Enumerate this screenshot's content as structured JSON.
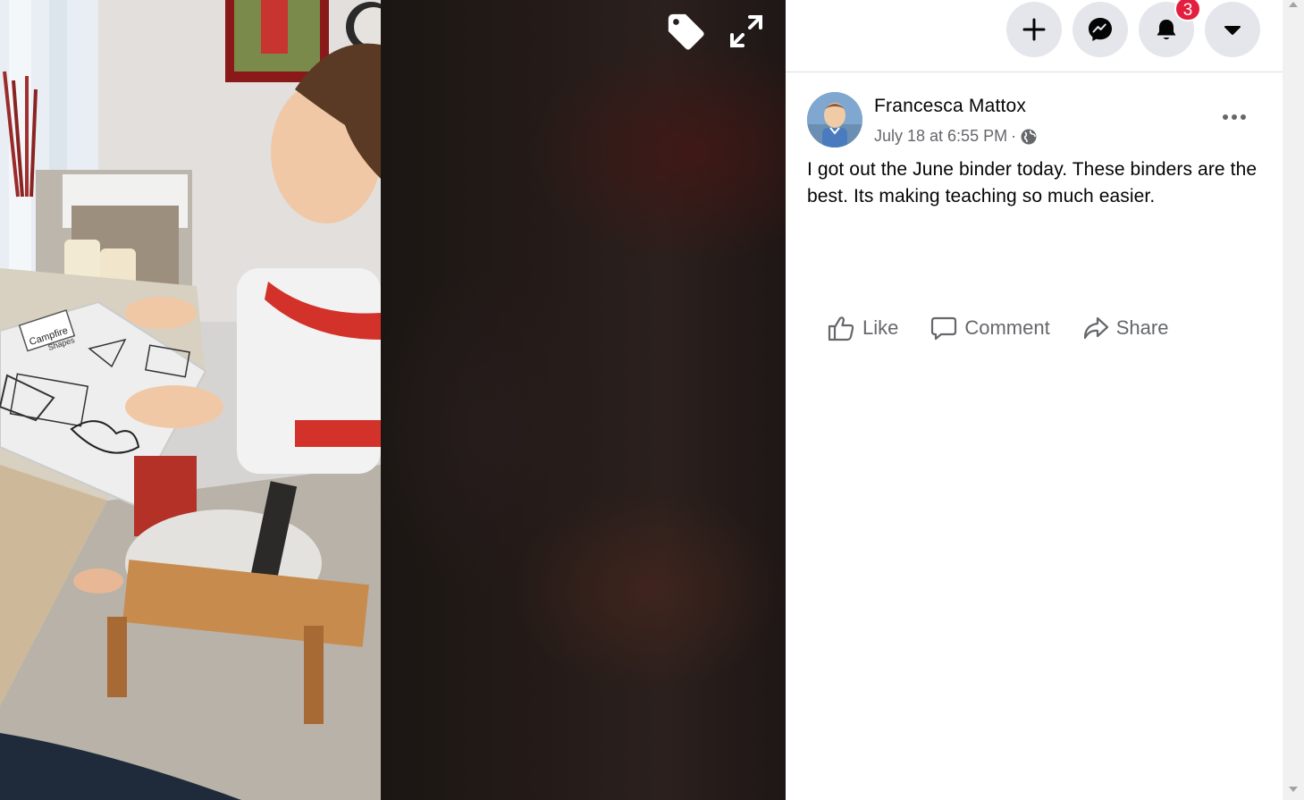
{
  "viewer": {
    "tag_icon": "tag-icon",
    "fullscreen_icon": "expand-icon",
    "photo_text": {
      "worksheet_title": "Campfire",
      "worksheet_subtitle": "Shapes"
    }
  },
  "topbar": {
    "buttons": [
      {
        "name": "create-button",
        "icon": "plus-icon"
      },
      {
        "name": "messenger-button",
        "icon": "messenger-icon"
      },
      {
        "name": "notifications-button",
        "icon": "bell-icon",
        "badge": "3"
      },
      {
        "name": "account-menu-button",
        "icon": "caret-down-icon"
      }
    ]
  },
  "post": {
    "author": "Francesca Mattox",
    "timestamp": "July 18 at 6:55 PM",
    "separator": "·",
    "privacy_icon": "globe-icon",
    "text": "I got out the June binder today. These binders are the best. Its making teaching so much easier.",
    "actions": {
      "like": "Like",
      "comment": "Comment",
      "share": "Share"
    }
  },
  "colors": {
    "badge": "#e41e3f",
    "nav_button_bg": "#e4e6eb",
    "secondary_text": "#65676b",
    "primary_text": "#050505"
  }
}
